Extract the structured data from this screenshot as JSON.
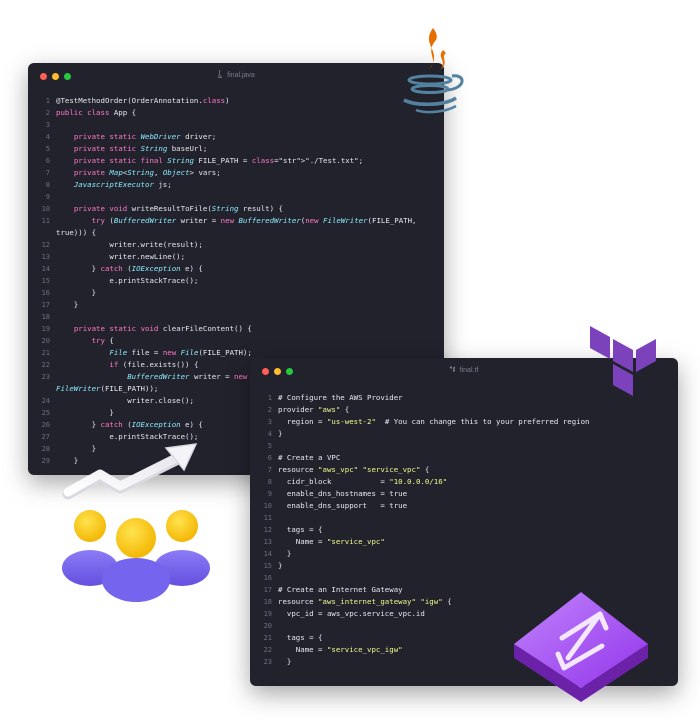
{
  "java_window": {
    "filename": "final.java",
    "lines": [
      {
        "n": "1",
        "text": "@TestMethodOrder(OrderAnnotation.class)"
      },
      {
        "n": "2",
        "text": "public class App {"
      },
      {
        "n": "3",
        "text": ""
      },
      {
        "n": "4",
        "text": "    private static WebDriver driver;"
      },
      {
        "n": "5",
        "text": "    private static String baseUrl;"
      },
      {
        "n": "6",
        "text": "    private static final String FILE_PATH = \"./Test.txt\";"
      },
      {
        "n": "7",
        "text": "    private Map<String, Object> vars;"
      },
      {
        "n": "8",
        "text": "    JavascriptExecutor js;"
      },
      {
        "n": "9",
        "text": ""
      },
      {
        "n": "10",
        "text": "    private void writeResultToFile(String result) {"
      },
      {
        "n": "11",
        "text": "        try (BufferedWriter writer = new BufferedWriter(new FileWriter(FILE_PATH,"
      },
      {
        "n": "",
        "text": "true))) {"
      },
      {
        "n": "12",
        "text": "            writer.write(result);"
      },
      {
        "n": "13",
        "text": "            writer.newLine();"
      },
      {
        "n": "14",
        "text": "        } catch (IOException e) {"
      },
      {
        "n": "15",
        "text": "            e.printStackTrace();"
      },
      {
        "n": "16",
        "text": "        }"
      },
      {
        "n": "17",
        "text": "    }"
      },
      {
        "n": "18",
        "text": ""
      },
      {
        "n": "19",
        "text": "    private static void clearFileContent() {"
      },
      {
        "n": "20",
        "text": "        try {"
      },
      {
        "n": "21",
        "text": "            File file = new File(FILE_PATH);"
      },
      {
        "n": "22",
        "text": "            if (file.exists()) {"
      },
      {
        "n": "23",
        "text": "                BufferedWriter writer = new BufferedWriter(new"
      },
      {
        "n": "",
        "text": "FileWriter(FILE_PATH));"
      },
      {
        "n": "24",
        "text": "                writer.close();"
      },
      {
        "n": "25",
        "text": "            }"
      },
      {
        "n": "26",
        "text": "        } catch (IOException e) {"
      },
      {
        "n": "27",
        "text": "            e.printStackTrace();"
      },
      {
        "n": "28",
        "text": "        }"
      },
      {
        "n": "29",
        "text": "    }"
      }
    ]
  },
  "tf_window": {
    "filename": "final.tf",
    "lines": [
      {
        "n": "1",
        "text": "# Configure the AWS Provider"
      },
      {
        "n": "2",
        "text": "provider \"aws\" {"
      },
      {
        "n": "3",
        "text": "  region = \"us-west-2\"  # You can change this to your preferred region"
      },
      {
        "n": "4",
        "text": "}"
      },
      {
        "n": "5",
        "text": ""
      },
      {
        "n": "6",
        "text": "# Create a VPC"
      },
      {
        "n": "7",
        "text": "resource \"aws_vpc\" \"service_vpc\" {"
      },
      {
        "n": "8",
        "text": "  cidr_block           = \"10.0.0.0/16\""
      },
      {
        "n": "9",
        "text": "  enable_dns_hostnames = true"
      },
      {
        "n": "10",
        "text": "  enable_dns_support   = true"
      },
      {
        "n": "11",
        "text": ""
      },
      {
        "n": "12",
        "text": "  tags = {"
      },
      {
        "n": "13",
        "text": "    Name = \"service_vpc\""
      },
      {
        "n": "14",
        "text": "  }"
      },
      {
        "n": "15",
        "text": "}"
      },
      {
        "n": "16",
        "text": ""
      },
      {
        "n": "17",
        "text": "# Create an Internet Gateway"
      },
      {
        "n": "18",
        "text": "resource \"aws_internet_gateway\" \"igw\" {"
      },
      {
        "n": "19",
        "text": "  vpc_id = aws_vpc.service_vpc.id"
      },
      {
        "n": "20",
        "text": ""
      },
      {
        "n": "21",
        "text": "  tags = {"
      },
      {
        "n": "22",
        "text": "    Name = \"service_vpc_igw\""
      },
      {
        "n": "23",
        "text": "  }"
      }
    ]
  },
  "icons": {
    "java": "java-logo-icon",
    "terraform": "terraform-logo-icon",
    "team": "team-growth-icon",
    "swap": "purple-arrows-tile-icon"
  },
  "colors": {
    "editor_bg": "#21222c",
    "java_orange": "#e76f00",
    "java_blue": "#5382a1",
    "terraform_purple": "#7b42bc",
    "tile_purple": "#9333ea"
  }
}
